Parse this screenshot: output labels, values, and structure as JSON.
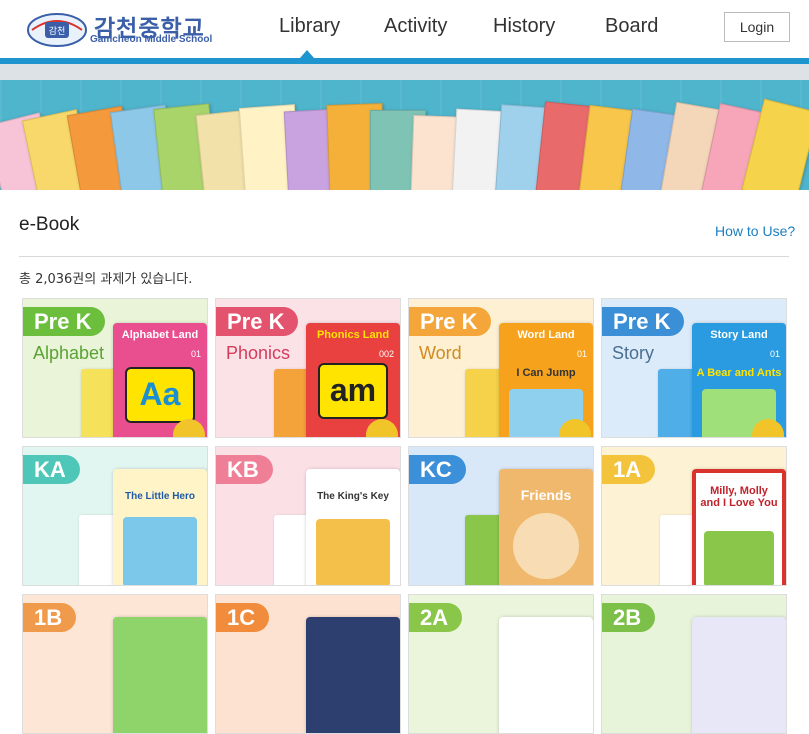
{
  "header": {
    "logo_ko": "감천중학교",
    "logo_en": "Gamcheon Middle School",
    "logo_emblem": "감천",
    "nav": [
      "Library",
      "Activity",
      "History",
      "Board"
    ],
    "login_label": "Login"
  },
  "section": {
    "title": "e-Book",
    "how_to": "How to Use?",
    "count_text": "총 2,036권의 과제가 있습니다."
  },
  "cards": [
    {
      "badge": "Pre K",
      "subtitle": "Alphabet",
      "cover_title": "Alphabet Land",
      "cover_big": "Aa",
      "cover_num": "01"
    },
    {
      "badge": "Pre K",
      "subtitle": "Phonics",
      "cover_title": "Phonics Land",
      "cover_big": "am",
      "cover_num": "002"
    },
    {
      "badge": "Pre K",
      "subtitle": "Word",
      "cover_title": "Word Land",
      "cover_big": "I Can Jump",
      "cover_num": "01"
    },
    {
      "badge": "Pre K",
      "subtitle": "Story",
      "cover_title": "Story Land",
      "cover_big": "A Bear and Ants",
      "cover_num": "01"
    },
    {
      "badge": "KA",
      "cover_title": "The Little Hero"
    },
    {
      "badge": "KB",
      "cover_title": "The King's Key"
    },
    {
      "badge": "KC",
      "cover_title": "Friends"
    },
    {
      "badge": "1A",
      "cover_title": "Milly, Molly and I Love You"
    },
    {
      "badge": "1B",
      "cover_title": ""
    },
    {
      "badge": "1C",
      "cover_title": ""
    },
    {
      "badge": "2A",
      "cover_title": ""
    },
    {
      "badge": "2B",
      "cover_title": ""
    }
  ],
  "colors": {
    "accent_blue": "#1e95cf",
    "prek_green": "#6cbf3c",
    "prek_pink": "#e4536e",
    "prek_orange": "#f4a63a",
    "prek_blue": "#3b8fd6",
    "ka": "#4fc7b8",
    "kb": "#ef7f96",
    "kc": "#3c8fd9",
    "1a": "#f4c33c",
    "1b": "#f09a4c",
    "1c": "#f08c3c",
    "2a": "#8ac64a",
    "2b": "#7cc04a"
  },
  "icons": {
    "logo": "school-emblem-icon",
    "nav_indicator": "caret-up-icon"
  }
}
